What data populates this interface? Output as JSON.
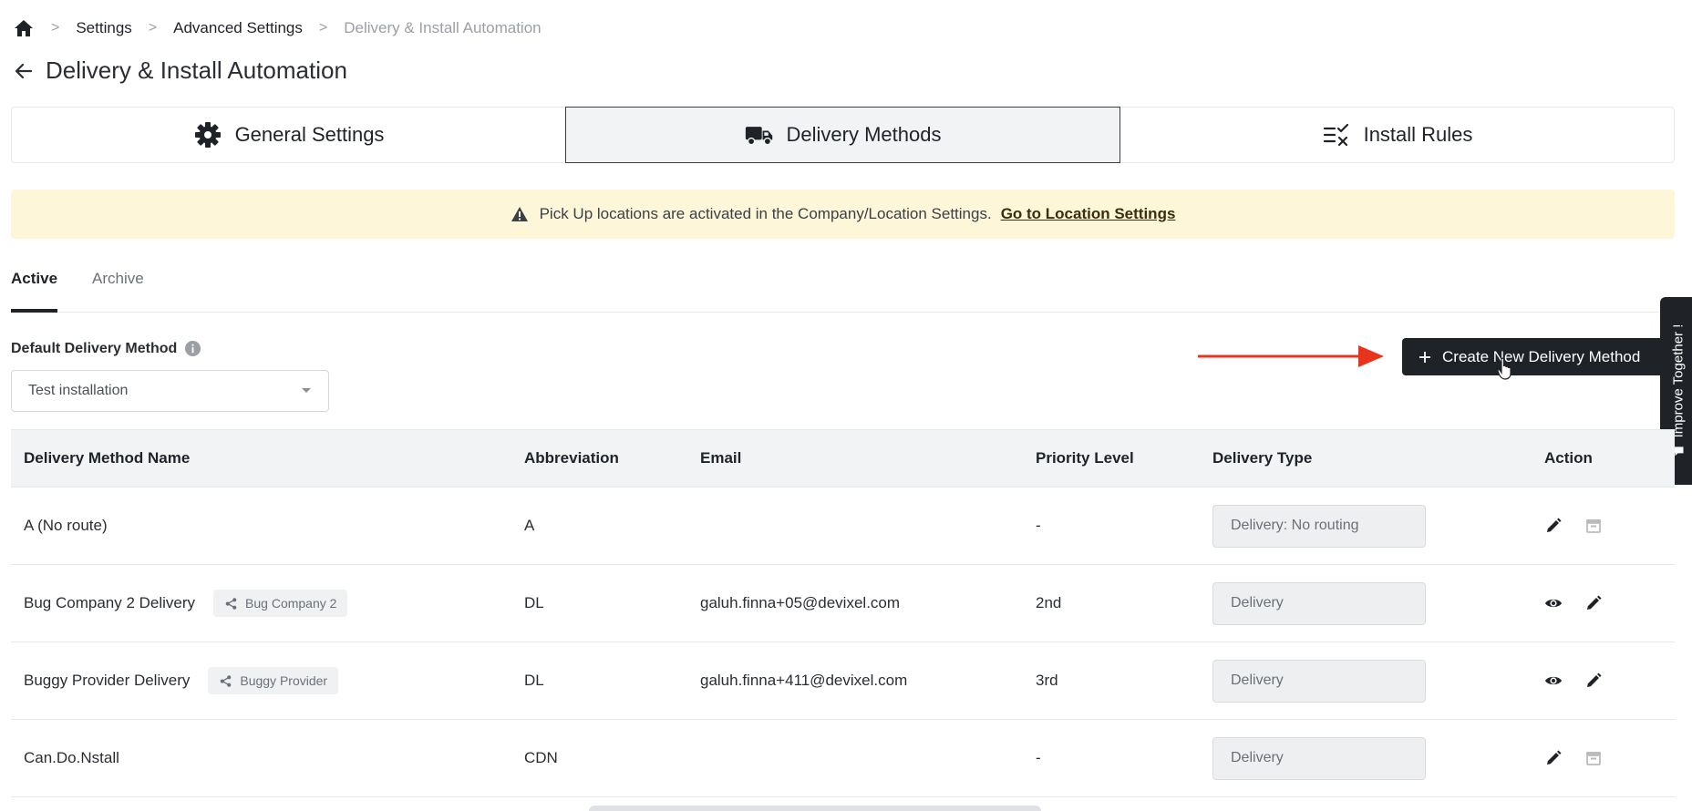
{
  "breadcrumb": {
    "items": [
      "Settings",
      "Advanced Settings",
      "Delivery & Install Automation"
    ]
  },
  "page_title": "Delivery & Install Automation",
  "main_tabs": [
    {
      "label": "General Settings",
      "icon": "gear-icon"
    },
    {
      "label": "Delivery Methods",
      "icon": "truck-icon",
      "active": true
    },
    {
      "label": "Install Rules",
      "icon": "rules-icon"
    }
  ],
  "banner": {
    "text": "Pick Up locations are activated in the Company/Location Settings.",
    "link": "Go to Location Settings",
    "color": "#fdf6d8"
  },
  "subtabs": [
    {
      "label": "Active",
      "active": true
    },
    {
      "label": "Archive"
    }
  ],
  "default_method": {
    "label": "Default Delivery Method",
    "value": "Test installation"
  },
  "create_button": {
    "label": "Create New Delivery Method",
    "color": "#1f2227"
  },
  "feedback_tab": {
    "label": "Improve Together !"
  },
  "table": {
    "headers": [
      "Delivery Method Name",
      "Abbreviation",
      "Email",
      "Priority Level",
      "Delivery Type",
      "Action"
    ],
    "rows": [
      {
        "name": "A (No route)",
        "tag": "",
        "abbr": "A",
        "email": "",
        "priority": "-",
        "type": "Delivery: No routing",
        "actions": [
          "edit",
          "archive-disabled"
        ]
      },
      {
        "name": "Bug Company 2 Delivery",
        "tag": "Bug Company 2",
        "abbr": "DL",
        "email": "galuh.finna+05@devixel.com",
        "priority": "2nd",
        "type": "Delivery",
        "actions": [
          "view",
          "edit"
        ]
      },
      {
        "name": "Buggy Provider Delivery",
        "tag": "Buggy Provider",
        "abbr": "DL",
        "email": "galuh.finna+411@devixel.com",
        "priority": "3rd",
        "type": "Delivery",
        "actions": [
          "view",
          "edit"
        ]
      },
      {
        "name": "Can.Do.Nstall",
        "tag": "",
        "abbr": "CDN",
        "email": "",
        "priority": "-",
        "type": "Delivery",
        "actions": [
          "edit",
          "archive-disabled"
        ]
      }
    ]
  },
  "accent_colors": {
    "annotation_arrow": "#e8341c"
  }
}
